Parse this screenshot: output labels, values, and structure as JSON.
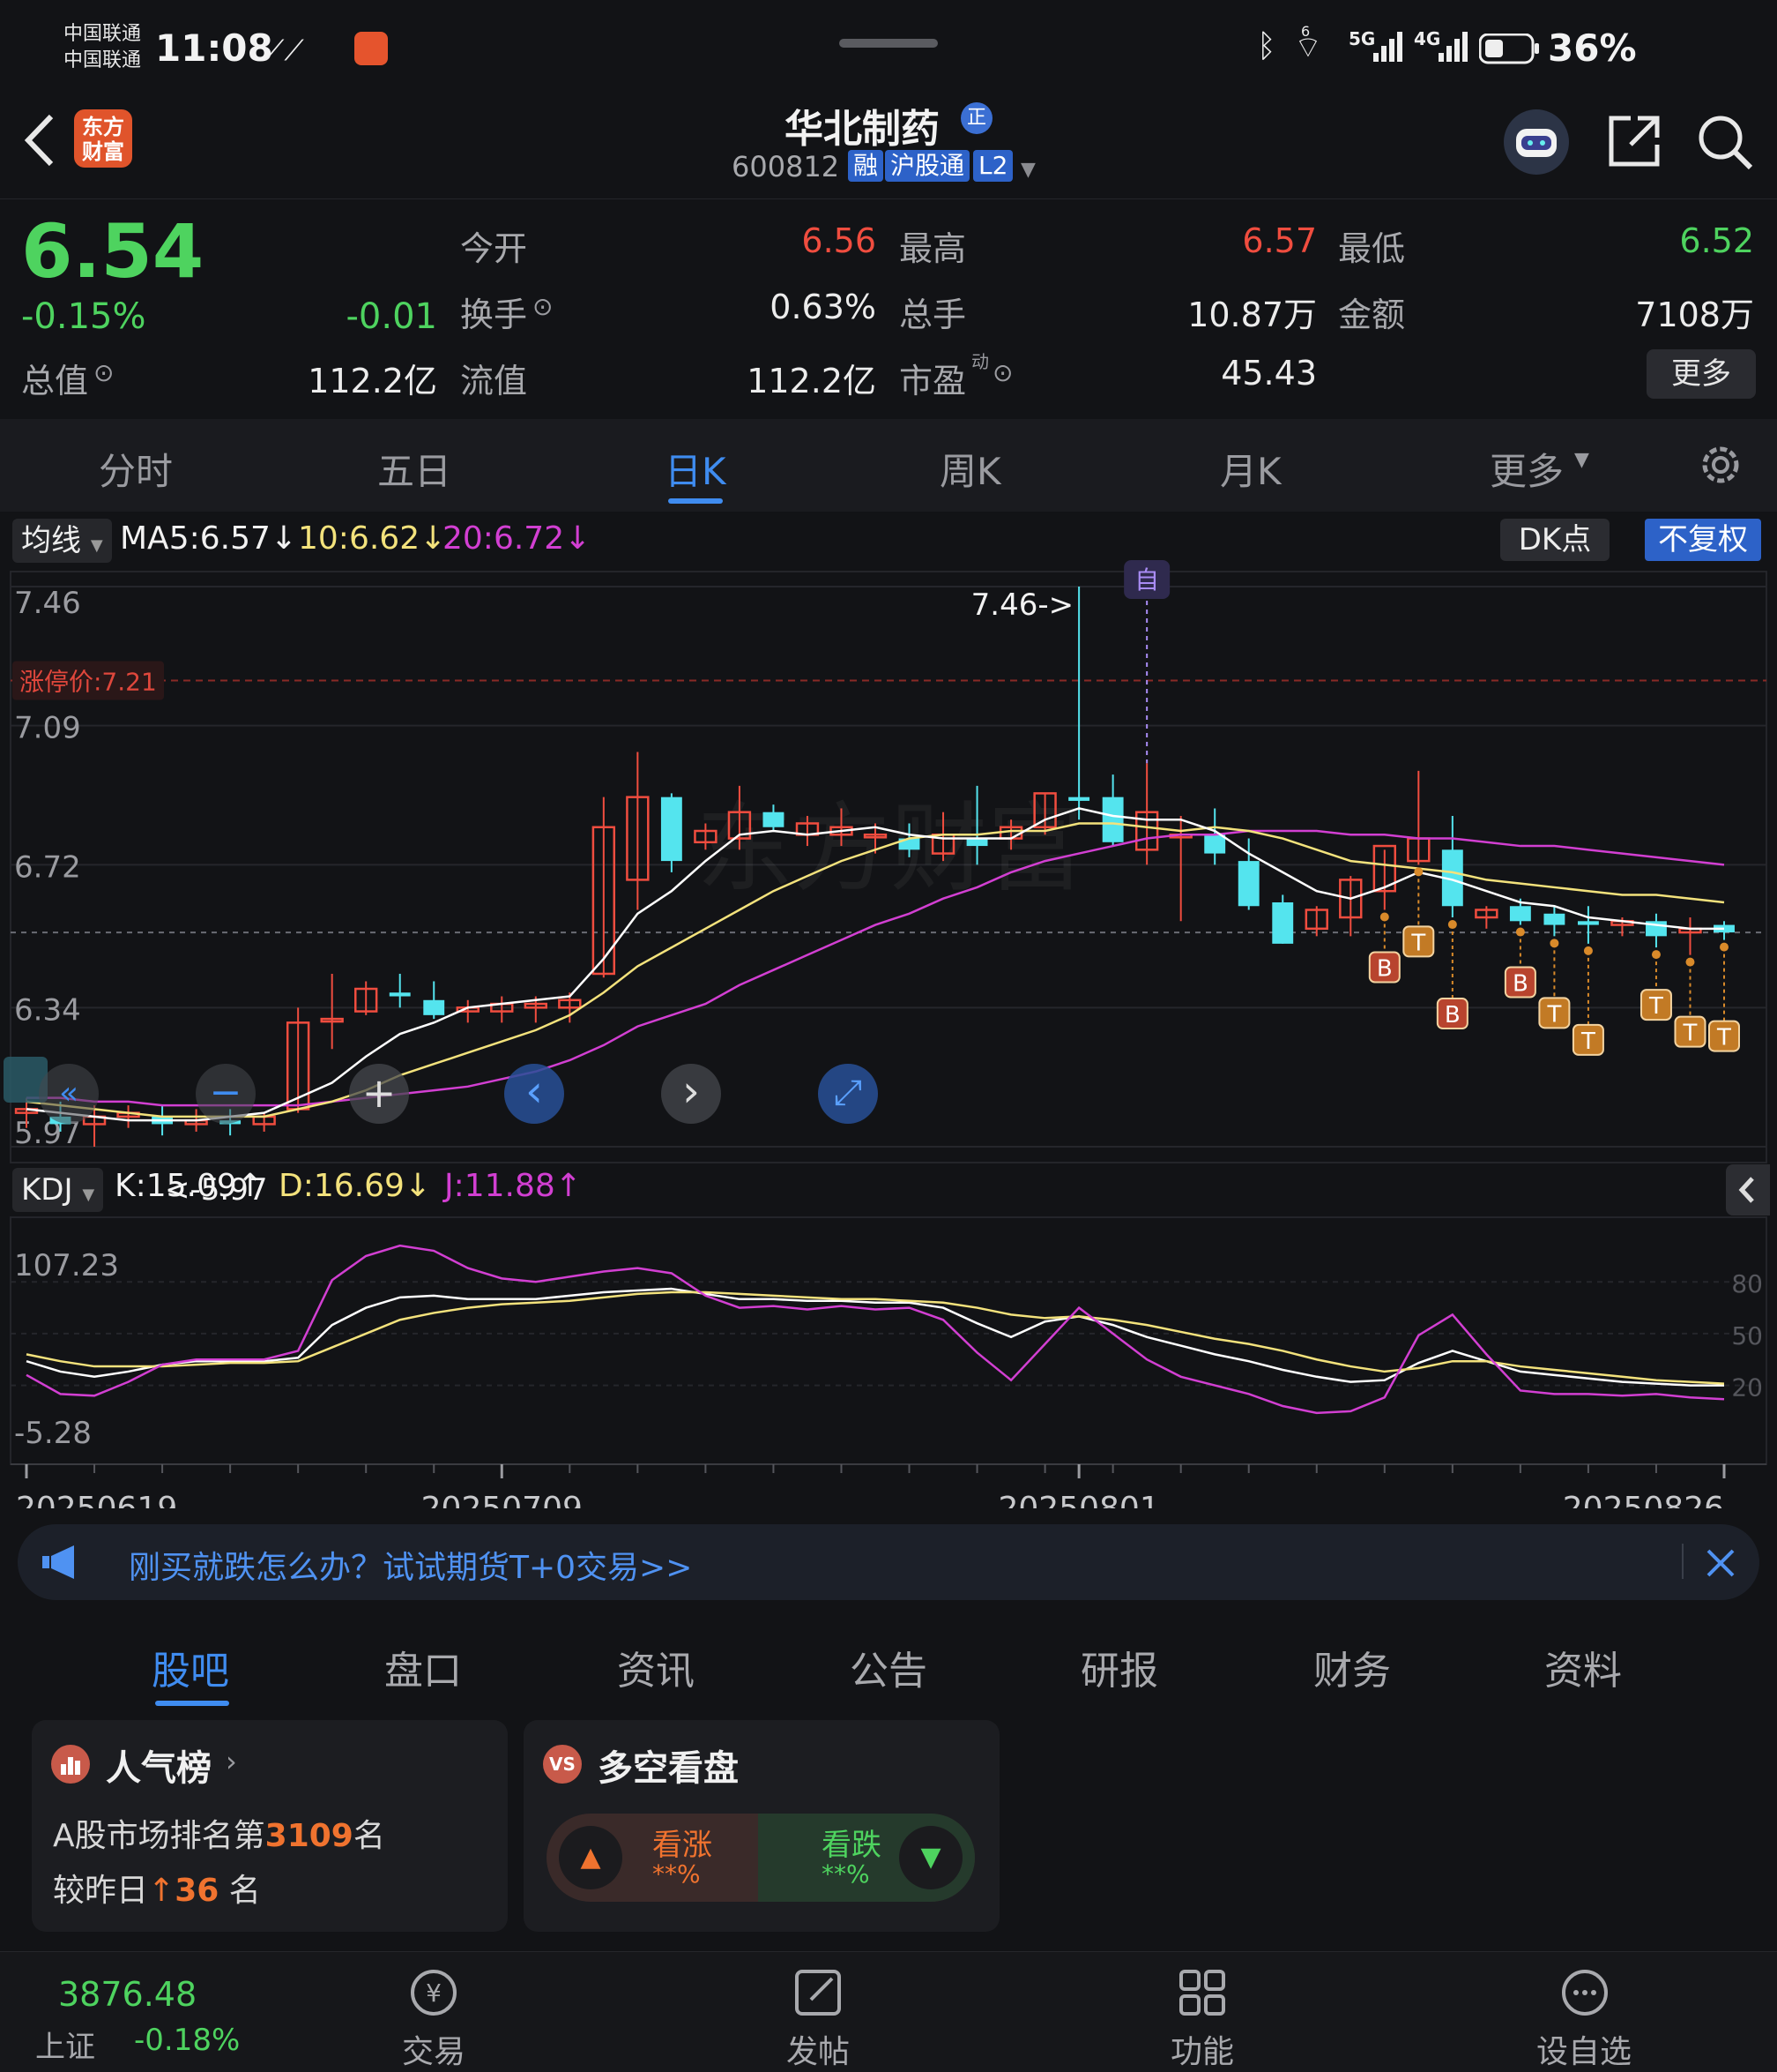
{
  "status_bar": {
    "carrier_1": "中国联通",
    "carrier_2": "中国联通",
    "time": "11:08",
    "network_5g": "5G",
    "network_4g": "4G",
    "wifi_sup": "6",
    "battery": "36%"
  },
  "header": {
    "logo_line1": "东方",
    "logo_line2": "财富",
    "stock_name": "华北制药",
    "badge": "正",
    "stock_code": "600812",
    "tag_margin": "融",
    "tag_connect": "沪股通",
    "tag_level": "L2"
  },
  "quote": {
    "price": "6.54",
    "change_pct": "-0.15%",
    "change": "-0.01",
    "open_label": "今开",
    "open": "6.56",
    "high_label": "最高",
    "high": "6.57",
    "low_label": "最低",
    "low": "6.52",
    "turnover_label": "换手",
    "turnover": "0.63%",
    "volume_label": "总手",
    "volume": "10.87万",
    "amount_label": "金额",
    "amount": "7108万",
    "mktcap_label": "总值",
    "mktcap": "112.2亿",
    "float_label": "流值",
    "float_cap": "112.2亿",
    "pe_label": "市盈",
    "pe_sup": "动",
    "pe": "45.43",
    "more_button": "更多"
  },
  "kline_tabs": [
    "分时",
    "五日",
    "日K",
    "周K",
    "月K",
    "更多"
  ],
  "active_tab": "日K",
  "ma_bar": {
    "selector": "均线",
    "ma5": "MA5:6.57↓",
    "ma10": "10:6.62↓",
    "ma20": "20:6.72↓",
    "dk_button": "DK点",
    "adjust_button": "不复权"
  },
  "kdj_bar": {
    "selector": "KDJ",
    "k": "K:15.09↑",
    "d": "D:16.69↓",
    "j": "J:11.88↑"
  },
  "colors": {
    "up": "#f04d3f",
    "down": "#54e4ee",
    "ma5": "#ffffff",
    "ma10": "#f3e27c",
    "ma20": "#d23fd2",
    "accent": "#3f8cf0"
  },
  "chart_data": [
    {
      "type": "candlestick",
      "title": "",
      "y_ticks": [
        "7.46",
        "7.09",
        "6.72",
        "6.34",
        "5.97"
      ],
      "ylim": [
        5.97,
        7.46
      ],
      "limit_up_label": "涨停价:7.21",
      "limit_up": 7.21,
      "current_line": 6.54,
      "max_annotation": "7.46->",
      "min_annotation": "<-5.97",
      "self_marker": "自",
      "x_ticks": [
        "20250619",
        "20250709",
        "20250801",
        "20250826"
      ],
      "candles": [
        {
          "o": 6.06,
          "h": 6.1,
          "l": 6.02,
          "c": 6.07
        },
        {
          "o": 6.05,
          "h": 6.09,
          "l": 6.01,
          "c": 6.03
        },
        {
          "o": 6.03,
          "h": 6.08,
          "l": 5.97,
          "c": 6.05
        },
        {
          "o": 6.05,
          "h": 6.08,
          "l": 6.02,
          "c": 6.06
        },
        {
          "o": 6.05,
          "h": 6.08,
          "l": 6.0,
          "c": 6.03
        },
        {
          "o": 6.03,
          "h": 6.07,
          "l": 6.01,
          "c": 6.04
        },
        {
          "o": 6.04,
          "h": 6.07,
          "l": 6.0,
          "c": 6.03
        },
        {
          "o": 6.03,
          "h": 6.06,
          "l": 6.01,
          "c": 6.05
        },
        {
          "o": 6.07,
          "h": 6.34,
          "l": 6.06,
          "c": 6.3
        },
        {
          "o": 6.31,
          "h": 6.43,
          "l": 6.23,
          "c": 6.31
        },
        {
          "o": 6.33,
          "h": 6.41,
          "l": 6.32,
          "c": 6.39
        },
        {
          "o": 6.38,
          "h": 6.43,
          "l": 6.34,
          "c": 6.37
        },
        {
          "o": 6.36,
          "h": 6.41,
          "l": 6.31,
          "c": 6.32
        },
        {
          "o": 6.33,
          "h": 6.36,
          "l": 6.3,
          "c": 6.34
        },
        {
          "o": 6.33,
          "h": 6.37,
          "l": 6.3,
          "c": 6.35
        },
        {
          "o": 6.34,
          "h": 6.37,
          "l": 6.3,
          "c": 6.35
        },
        {
          "o": 6.34,
          "h": 6.38,
          "l": 6.3,
          "c": 6.36
        },
        {
          "o": 6.43,
          "h": 6.9,
          "l": 6.42,
          "c": 6.82
        },
        {
          "o": 6.68,
          "h": 7.02,
          "l": 6.6,
          "c": 6.9
        },
        {
          "o": 6.9,
          "h": 6.91,
          "l": 6.7,
          "c": 6.73
        },
        {
          "o": 6.78,
          "h": 6.83,
          "l": 6.76,
          "c": 6.81
        },
        {
          "o": 6.79,
          "h": 6.93,
          "l": 6.76,
          "c": 6.86
        },
        {
          "o": 6.86,
          "h": 6.88,
          "l": 6.81,
          "c": 6.82
        },
        {
          "o": 6.8,
          "h": 6.85,
          "l": 6.77,
          "c": 6.83
        },
        {
          "o": 6.8,
          "h": 6.87,
          "l": 6.77,
          "c": 6.82
        },
        {
          "o": 6.8,
          "h": 6.83,
          "l": 6.75,
          "c": 6.8
        },
        {
          "o": 6.79,
          "h": 6.83,
          "l": 6.74,
          "c": 6.76
        },
        {
          "o": 6.75,
          "h": 6.86,
          "l": 6.73,
          "c": 6.8
        },
        {
          "o": 6.79,
          "h": 6.93,
          "l": 6.72,
          "c": 6.77
        },
        {
          "o": 6.79,
          "h": 6.84,
          "l": 6.76,
          "c": 6.82
        },
        {
          "o": 6.82,
          "h": 6.91,
          "l": 6.8,
          "c": 6.91
        },
        {
          "o": 6.9,
          "h": 7.46,
          "l": 6.84,
          "c": 6.89
        },
        {
          "o": 6.9,
          "h": 6.96,
          "l": 6.77,
          "c": 6.78
        },
        {
          "o": 6.76,
          "h": 6.99,
          "l": 6.72,
          "c": 6.86
        },
        {
          "o": 6.8,
          "h": 6.85,
          "l": 6.57,
          "c": 6.8
        },
        {
          "o": 6.8,
          "h": 6.87,
          "l": 6.72,
          "c": 6.75
        },
        {
          "o": 6.73,
          "h": 6.79,
          "l": 6.6,
          "c": 6.61
        },
        {
          "o": 6.62,
          "h": 6.64,
          "l": 6.51,
          "c": 6.51
        },
        {
          "o": 6.55,
          "h": 6.61,
          "l": 6.53,
          "c": 6.6
        },
        {
          "o": 6.58,
          "h": 6.69,
          "l": 6.53,
          "c": 6.68
        },
        {
          "o": 6.65,
          "h": 6.76,
          "l": 6.6,
          "c": 6.77
        },
        {
          "o": 6.73,
          "h": 6.97,
          "l": 6.72,
          "c": 6.79
        },
        {
          "o": 6.76,
          "h": 6.85,
          "l": 6.58,
          "c": 6.61
        },
        {
          "o": 6.58,
          "h": 6.61,
          "l": 6.55,
          "c": 6.6
        },
        {
          "o": 6.61,
          "h": 6.63,
          "l": 6.56,
          "c": 6.57
        },
        {
          "o": 6.59,
          "h": 6.61,
          "l": 6.53,
          "c": 6.56
        },
        {
          "o": 6.57,
          "h": 6.61,
          "l": 6.51,
          "c": 6.56
        },
        {
          "o": 6.56,
          "h": 6.58,
          "l": 6.53,
          "c": 6.57
        },
        {
          "o": 6.57,
          "h": 6.59,
          "l": 6.5,
          "c": 6.53
        },
        {
          "o": 6.54,
          "h": 6.58,
          "l": 6.48,
          "c": 6.55
        },
        {
          "o": 6.56,
          "h": 6.57,
          "l": 6.52,
          "c": 6.54
        }
      ],
      "ma5": [
        6.07,
        6.06,
        6.05,
        6.04,
        6.04,
        6.04,
        6.05,
        6.06,
        6.1,
        6.14,
        6.21,
        6.27,
        6.3,
        6.34,
        6.35,
        6.36,
        6.37,
        6.47,
        6.59,
        6.65,
        6.73,
        6.8,
        6.81,
        6.8,
        6.81,
        6.82,
        6.8,
        6.79,
        6.79,
        6.79,
        6.84,
        6.87,
        6.85,
        6.84,
        6.84,
        6.81,
        6.75,
        6.7,
        6.65,
        6.63,
        6.66,
        6.7,
        6.68,
        6.65,
        6.62,
        6.61,
        6.58,
        6.57,
        6.56,
        6.55,
        6.55
      ],
      "ma10": [
        6.09,
        6.08,
        6.07,
        6.06,
        6.05,
        6.05,
        6.05,
        6.05,
        6.07,
        6.09,
        6.12,
        6.16,
        6.19,
        6.22,
        6.25,
        6.28,
        6.32,
        6.38,
        6.45,
        6.5,
        6.55,
        6.6,
        6.65,
        6.69,
        6.73,
        6.76,
        6.79,
        6.8,
        6.8,
        6.81,
        6.81,
        6.83,
        6.83,
        6.82,
        6.81,
        6.82,
        6.81,
        6.79,
        6.76,
        6.73,
        6.72,
        6.71,
        6.7,
        6.68,
        6.67,
        6.66,
        6.65,
        6.64,
        6.64,
        6.63,
        6.62
      ],
      "ma20": [
        6.1,
        6.1,
        6.09,
        6.09,
        6.08,
        6.08,
        6.08,
        6.08,
        6.08,
        6.09,
        6.1,
        6.11,
        6.12,
        6.13,
        6.15,
        6.17,
        6.2,
        6.24,
        6.29,
        6.32,
        6.35,
        6.4,
        6.44,
        6.48,
        6.52,
        6.56,
        6.59,
        6.63,
        6.66,
        6.7,
        6.73,
        6.75,
        6.77,
        6.79,
        6.8,
        6.8,
        6.81,
        6.81,
        6.81,
        6.8,
        6.8,
        6.79,
        6.79,
        6.78,
        6.77,
        6.77,
        6.76,
        6.75,
        6.74,
        6.73,
        6.72
      ],
      "markers": [
        {
          "index": 40,
          "label": "B"
        },
        {
          "index": 41,
          "label": "T"
        },
        {
          "index": 42,
          "label": "B"
        },
        {
          "index": 44,
          "label": "B"
        },
        {
          "index": 45,
          "label": "T"
        },
        {
          "index": 46,
          "label": "T"
        },
        {
          "index": 48,
          "label": "T"
        },
        {
          "index": 49,
          "label": "T"
        },
        {
          "index": 50,
          "label": "T"
        }
      ]
    },
    {
      "type": "line",
      "title": "KDJ",
      "y_ticks": [
        "107.23",
        "-5.28"
      ],
      "ylim": [
        -5.28,
        107.23
      ],
      "right_ticks": [
        "80",
        "50",
        "20"
      ],
      "series": [
        {
          "name": "K",
          "values": [
            34,
            28,
            25,
            28,
            32,
            34,
            34,
            34,
            36,
            55,
            65,
            71,
            72,
            70,
            70,
            70,
            72,
            74,
            75,
            76,
            73,
            70,
            70,
            69,
            69,
            68,
            68,
            65,
            56,
            48,
            57,
            60,
            55,
            48,
            43,
            38,
            34,
            29,
            25,
            22,
            23,
            33,
            40,
            34,
            28,
            26,
            24,
            22,
            21,
            20,
            20
          ]
        },
        {
          "name": "D",
          "values": [
            38,
            34,
            31,
            31,
            31,
            32,
            33,
            33,
            34,
            42,
            50,
            58,
            62,
            65,
            67,
            68,
            69,
            71,
            73,
            74,
            74,
            73,
            72,
            71,
            70,
            70,
            69,
            68,
            65,
            61,
            59,
            60,
            58,
            55,
            51,
            47,
            44,
            40,
            35,
            31,
            28,
            30,
            34,
            34,
            31,
            29,
            27,
            25,
            23,
            22,
            21
          ]
        },
        {
          "name": "J",
          "values": [
            26,
            15,
            14,
            22,
            32,
            35,
            35,
            35,
            40,
            81,
            95,
            101,
            98,
            88,
            82,
            80,
            83,
            86,
            88,
            85,
            72,
            65,
            66,
            64,
            66,
            64,
            65,
            58,
            39,
            23,
            44,
            65,
            50,
            35,
            25,
            20,
            15,
            8,
            4,
            5,
            13,
            49,
            61,
            38,
            17,
            15,
            15,
            14,
            15,
            13,
            12
          ]
        }
      ]
    }
  ],
  "chart_controls": {
    "zoom_out": "−",
    "zoom_in": "+",
    "pan_left": "‹",
    "pan_right": "›",
    "expand": "⤢"
  },
  "banner": {
    "text": "刚买就跌怎么办？试试期货T+0交易>>"
  },
  "sub_tabs": [
    "股吧",
    "盘口",
    "资讯",
    "公告",
    "研报",
    "财务",
    "资料"
  ],
  "active_sub_tab": "股吧",
  "popularity_card": {
    "title": "人气榜",
    "rank_prefix": "A股市场排名第",
    "rank": "3109",
    "rank_suffix": "名",
    "change_prefix": "较昨日",
    "change": "36",
    "change_suffix": "名"
  },
  "bullbear_card": {
    "title": "多空看盘",
    "up_label": "看涨",
    "up_value": "**%",
    "down_label": "看跌",
    "down_value": "**%"
  },
  "bottom_nav": {
    "index_value": "3876.48",
    "index_name": "上证",
    "index_change": "-0.18%",
    "items": [
      "交易",
      "发帖",
      "功能",
      "设自选"
    ]
  },
  "watermark": "东方财富"
}
